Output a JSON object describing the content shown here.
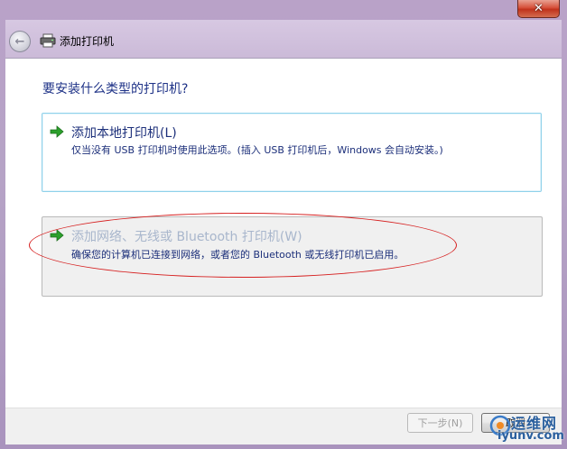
{
  "window": {
    "close_label": "✕",
    "title": "添加打印机",
    "back_icon": "back-arrow-icon",
    "printer_icon": "printer-icon"
  },
  "main": {
    "question": "要安装什么类型的打印机?",
    "options": [
      {
        "title": "添加本地打印机(L)",
        "description": "仅当没有 USB 打印机时使用此选项。(插入 USB 打印机后，Windows 会自动安装。)",
        "icon": "green-arrow-icon"
      },
      {
        "title": "添加网络、无线或 Bluetooth 打印机(W)",
        "description": "确保您的计算机已连接到网络，或者您的 Bluetooth 或无线打印机已启用。",
        "icon": "green-arrow-icon"
      }
    ]
  },
  "footer": {
    "next_label": "下一步(N)",
    "cancel_label": "取消"
  },
  "watermark": {
    "line1": "运维网",
    "line2": "iyunv.com"
  },
  "colors": {
    "frame": "#b6a3c6",
    "heading": "#1e3287",
    "highlight_ellipse": "#d62020",
    "arrow": "#2ca02c"
  }
}
